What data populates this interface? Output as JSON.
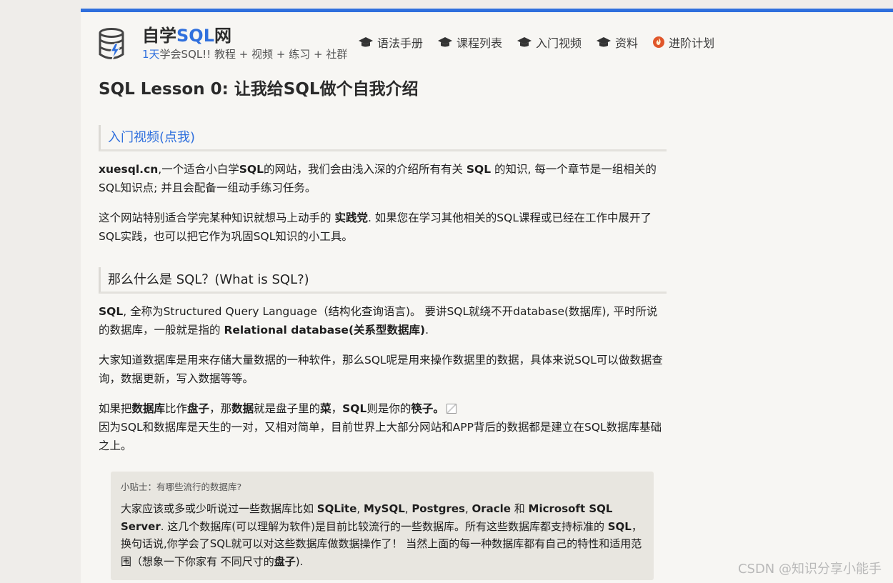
{
  "brand": {
    "title_prefix": "自学",
    "title_highlight": "SQL",
    "title_suffix": "网",
    "subtitle_highlight": "1天",
    "subtitle_rest": "学会SQL!! 教程 + 视频 + 练习 + 社群"
  },
  "nav": [
    {
      "label": "语法手册",
      "icon": "graduation-cap-icon"
    },
    {
      "label": "课程列表",
      "icon": "graduation-cap-icon"
    },
    {
      "label": "入门视频",
      "icon": "graduation-cap-icon"
    },
    {
      "label": "资料",
      "icon": "graduation-cap-icon"
    },
    {
      "label": "进阶计划",
      "icon": "fire-badge-icon"
    }
  ],
  "page_title": "SQL Lesson 0: 让我给SQL做个自我介绍",
  "section1": {
    "heading": "入门视频(点我)",
    "p1": {
      "a": "xuesql.cn",
      "b": ",一个适合小白学",
      "c": "SQL",
      "d": "的网站，我们会由浅入深的介绍所有有关 ",
      "e": "SQL",
      "f": " 的知识, 每一个章节是一组相关的SQL知识点; 并且会配备一组动手练习任务。"
    },
    "p2": {
      "a": "这个网站特别适合学完某种知识就想马上动手的 ",
      "b": "实践党",
      "c": ". 如果您在学习其他相关的SQL课程或已经在工作中展开了SQL实践，也可以把它作为巩固SQL知识的小工具。"
    }
  },
  "section2": {
    "heading": "那么什么是 SQL？(What is SQL?)",
    "p1": {
      "a": "SQL",
      "b": ", 全称为Structured Query Language（结构化查询语言)。 要讲SQL就绕不开database(数据库), 平时所说的数据库，一般就是指的 ",
      "c": "Relational database(关系型数据库)",
      "d": "."
    },
    "p2": "大家知道数据库是用来存储大量数据的一种软件，那么SQL呢是用来操作数据里的数据，具体来说SQL可以做数据查询，数据更新，写入数据等等。",
    "p3": {
      "a": "如果把",
      "b": "数据库",
      "c": "比作",
      "d": "盘子",
      "e": "，那",
      "f": "数据",
      "g": "就是盘子里的",
      "h": "菜",
      "i": "，",
      "j": "SQL",
      "k": "则是你的",
      "l": "筷子。",
      "m": "因为SQL和数据库是天生的一对，又相对简单，目前世界上大部分网站和APP背后的数据都是建立在SQL数据库基础之上。"
    }
  },
  "tip": {
    "title": "小贴士：有哪些流行的数据库?",
    "a": "大家应该或多或少听说过一些数据库比如 ",
    "b": "SQLite",
    "c": ", ",
    "d": "MySQL",
    "e": ", ",
    "f": "Postgres",
    "g": ", ",
    "h": "Oracle",
    "i": " 和 ",
    "j": "Microsoft SQL Server",
    "k": ". 这几个数据库(可以理解为软件)是目前比较流行的一些数据库。所有这些数据库都支持标准的 ",
    "l": "SQL",
    "m": "，换句话说,你学会了SQL就可以对这些数据库做数据操作了！ 当然上面的每一种数据库都有自己的特性和适用范围（想象一下你家有 不同尺寸的",
    "n": "盘子",
    "o": ")."
  },
  "watermark": "CSDN @知识分享小能手",
  "colors": {
    "accent": "#2f6fdd",
    "page_bg": "#f7f6f3",
    "tip_bg": "#e8e6e0",
    "fire": "#e0562a"
  }
}
